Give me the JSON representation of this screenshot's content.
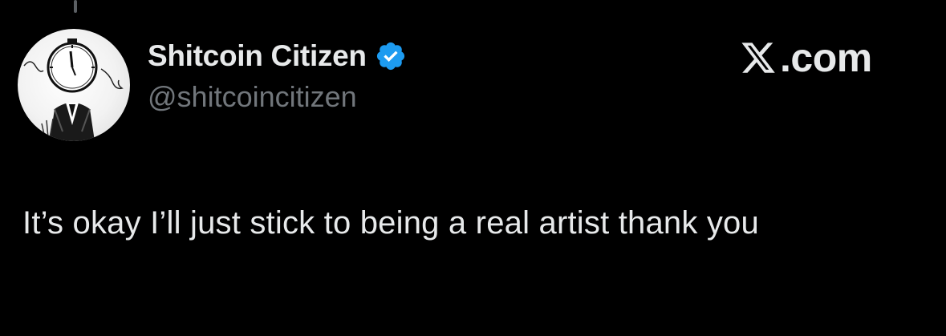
{
  "author": {
    "display_name": "Shitcoin Citizen",
    "handle": "@shitcoincitizen",
    "verified": true,
    "verified_color": "#1d9bf0",
    "avatar_icon": "clock-head-figure-avatar"
  },
  "brand": {
    "label": ".com",
    "icon": "x-logo-icon"
  },
  "tweet": {
    "text": "It’s okay I’ll just stick to being a real artist thank you"
  },
  "colors": {
    "background": "#000000",
    "primary_text": "#e7e9ea",
    "secondary_text": "#71767b"
  }
}
